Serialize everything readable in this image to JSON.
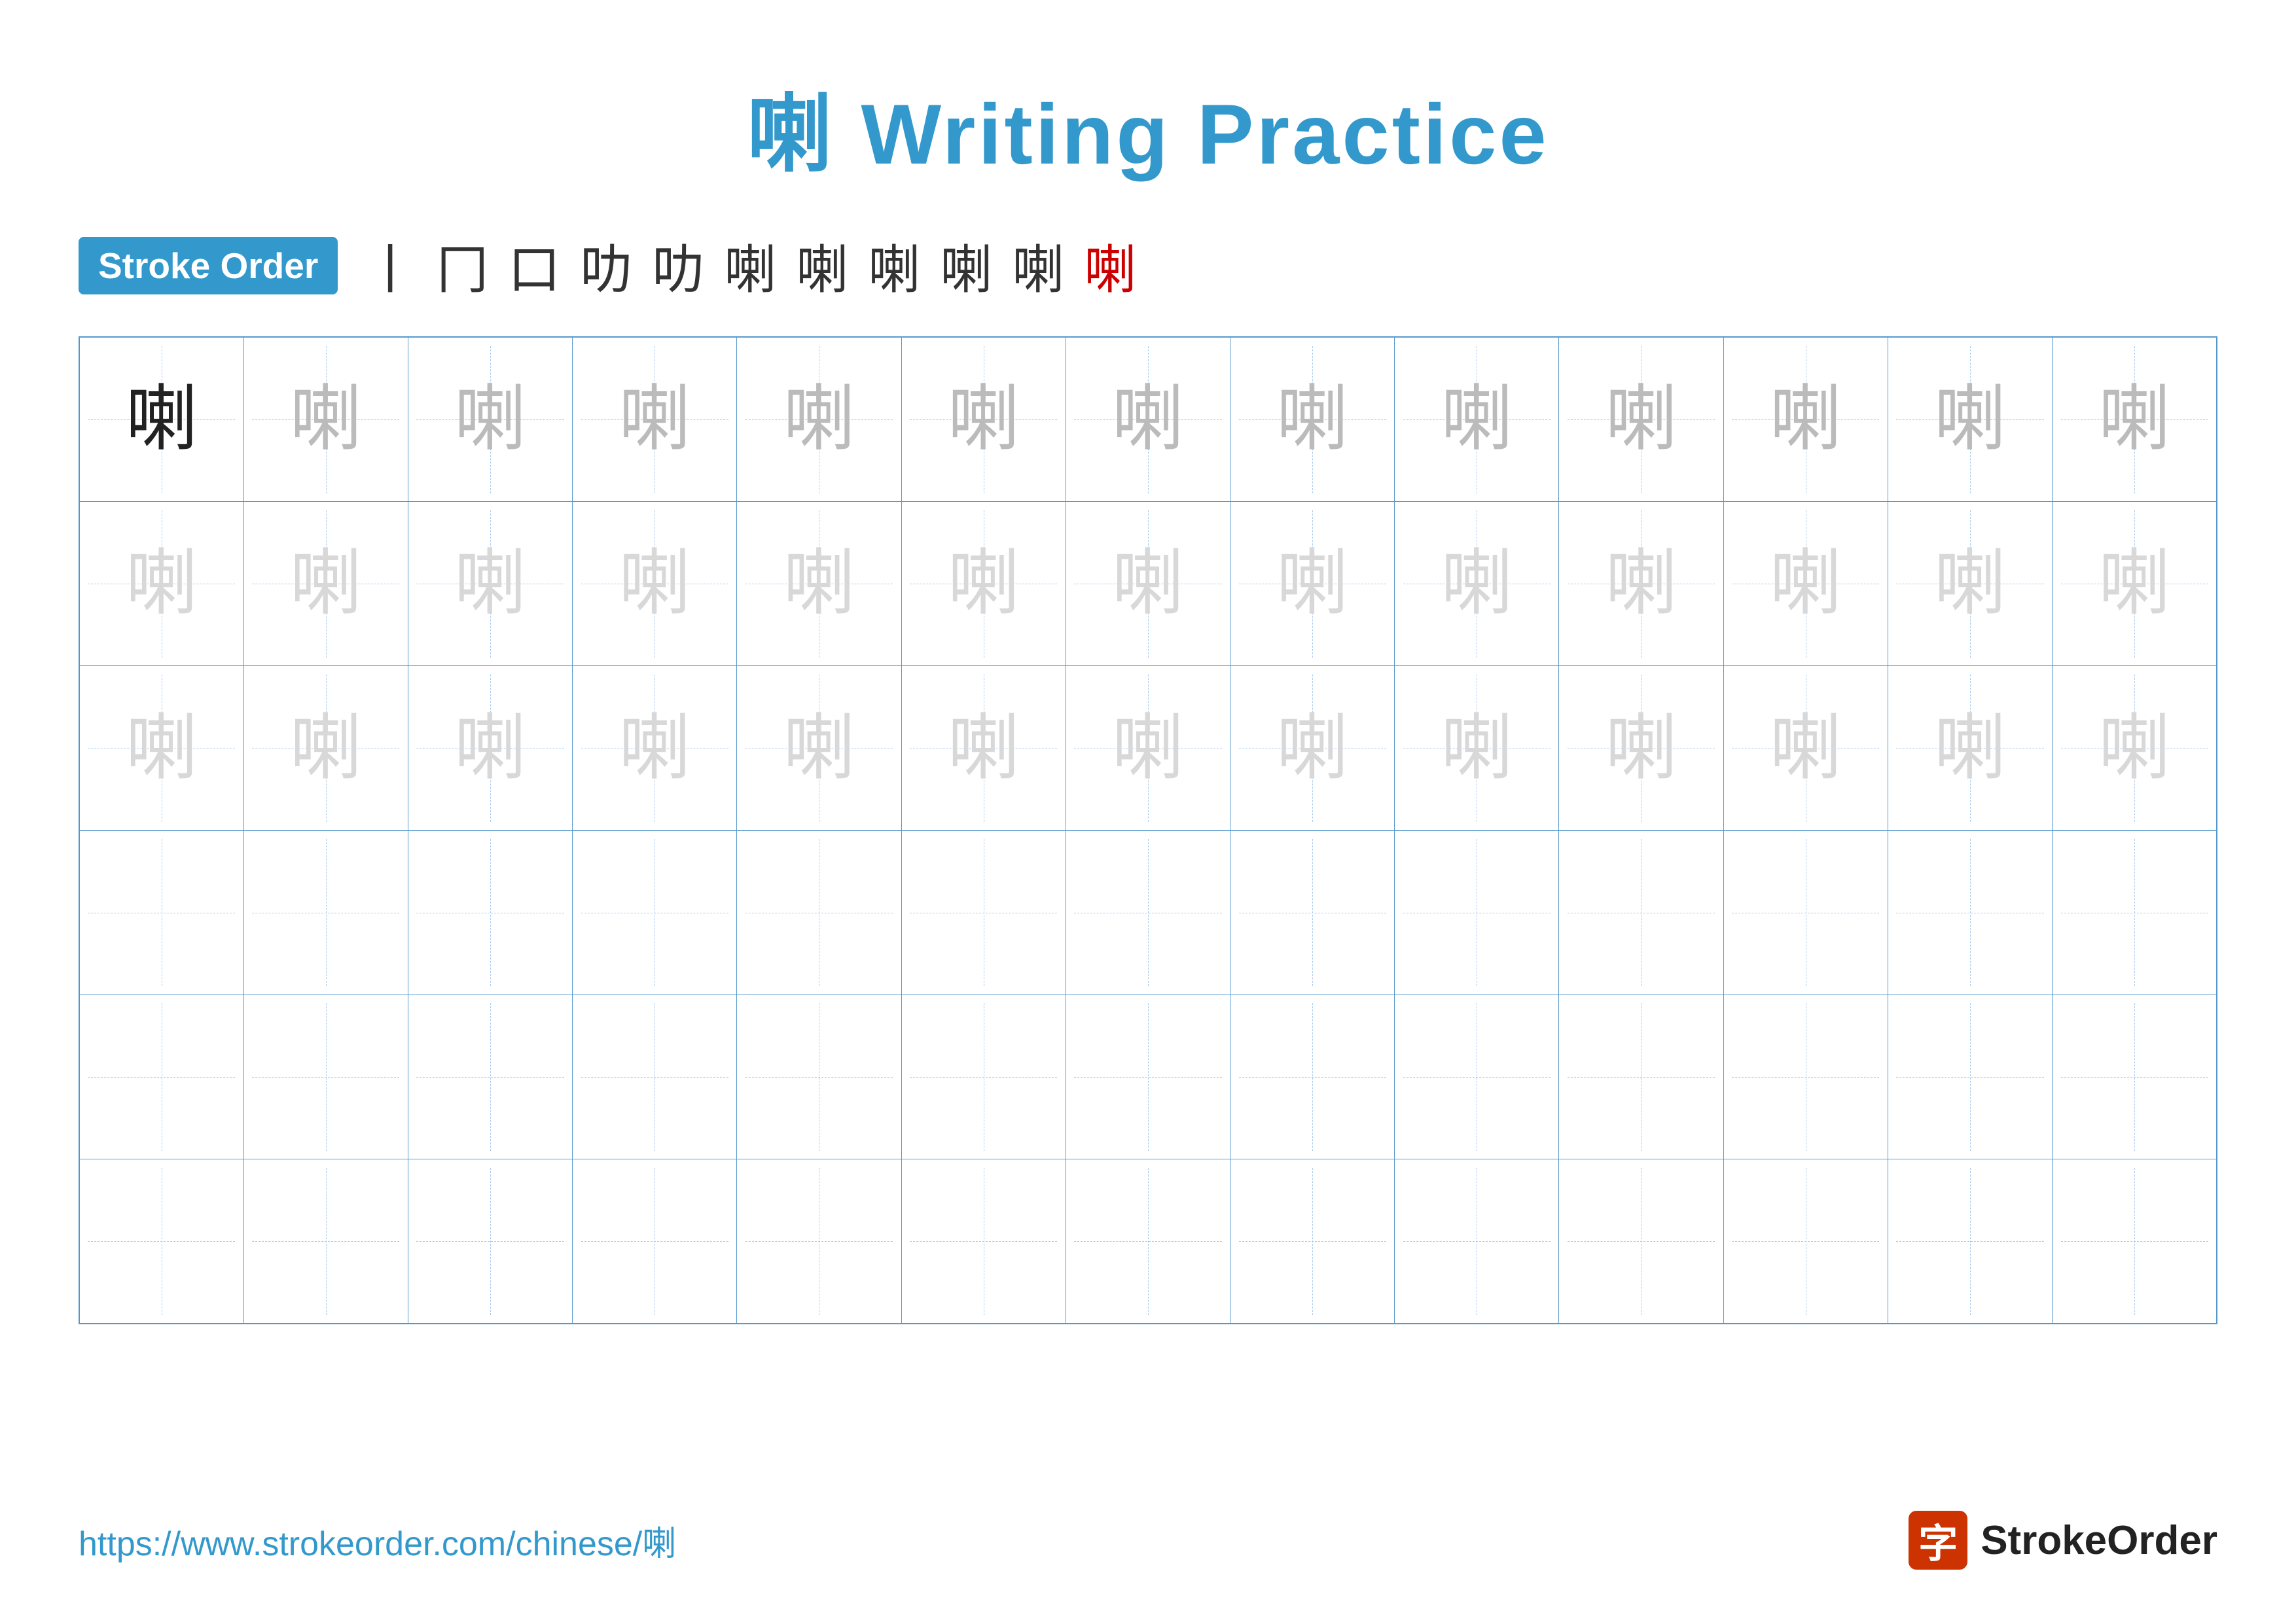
{
  "title": "喇 Writing Practice",
  "stroke_order": {
    "badge_label": "Stroke Order",
    "steps": [
      "丨",
      "冂",
      "口",
      "口丿",
      "口乛",
      "叻刀",
      "叻力",
      "喇-7",
      "喇-8",
      "喇-9",
      "喇"
    ]
  },
  "character": "喇",
  "rows": [
    {
      "type": "solid_then_medium",
      "solid_count": 1,
      "medium_count": 12
    },
    {
      "type": "light",
      "count": 13
    },
    {
      "type": "light",
      "count": 13
    },
    {
      "type": "empty",
      "count": 13
    },
    {
      "type": "empty",
      "count": 13
    },
    {
      "type": "empty",
      "count": 13
    }
  ],
  "footer": {
    "url": "https://www.strokeorder.com/chinese/喇",
    "logo_char": "字",
    "logo_text": "StrokeOrder"
  }
}
